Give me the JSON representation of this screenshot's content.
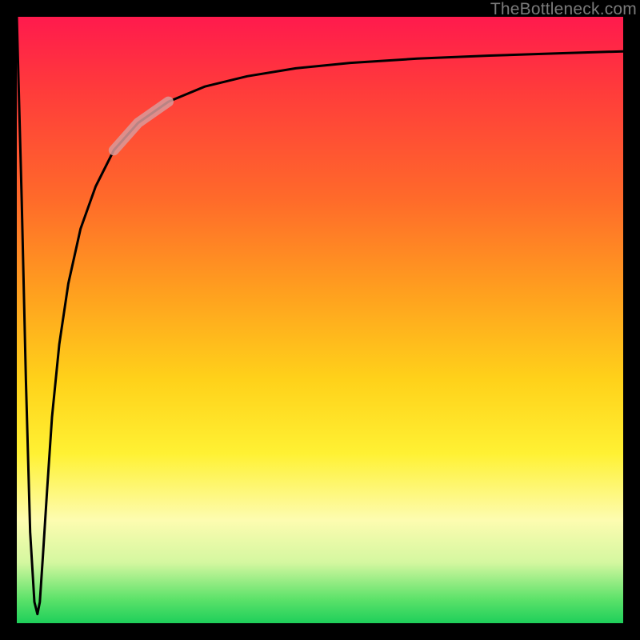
{
  "watermark": {
    "text": "TheBottleneck.com"
  },
  "chart_data": {
    "type": "line",
    "title": "",
    "xlabel": "",
    "ylabel": "",
    "xlim": [
      0,
      100
    ],
    "ylim": [
      0,
      100
    ],
    "grid": false,
    "legend": false,
    "annotations": [],
    "series": [
      {
        "name": "bottleneck-curve",
        "color": "#000000",
        "x": [
          0.0,
          0.8,
          1.5,
          2.2,
          2.9,
          3.4,
          3.8,
          4.3,
          5.0,
          5.8,
          7.0,
          8.5,
          10.5,
          13.0,
          16.0,
          20.0,
          25.0,
          31.0,
          38.0,
          46.0,
          55.0,
          66.0,
          78.0,
          90.0,
          100.0
        ],
        "y": [
          100.0,
          70.0,
          40.0,
          15.0,
          3.5,
          1.5,
          3.5,
          11.0,
          22.0,
          34.0,
          46.0,
          56.0,
          65.0,
          72.0,
          78.0,
          82.5,
          86.0,
          88.5,
          90.2,
          91.5,
          92.4,
          93.1,
          93.6,
          94.0,
          94.3
        ]
      },
      {
        "name": "highlight-segment",
        "color": "#d99a9a",
        "x": [
          16.0,
          20.0,
          25.0
        ],
        "y": [
          78.0,
          82.5,
          86.0
        ]
      }
    ]
  }
}
